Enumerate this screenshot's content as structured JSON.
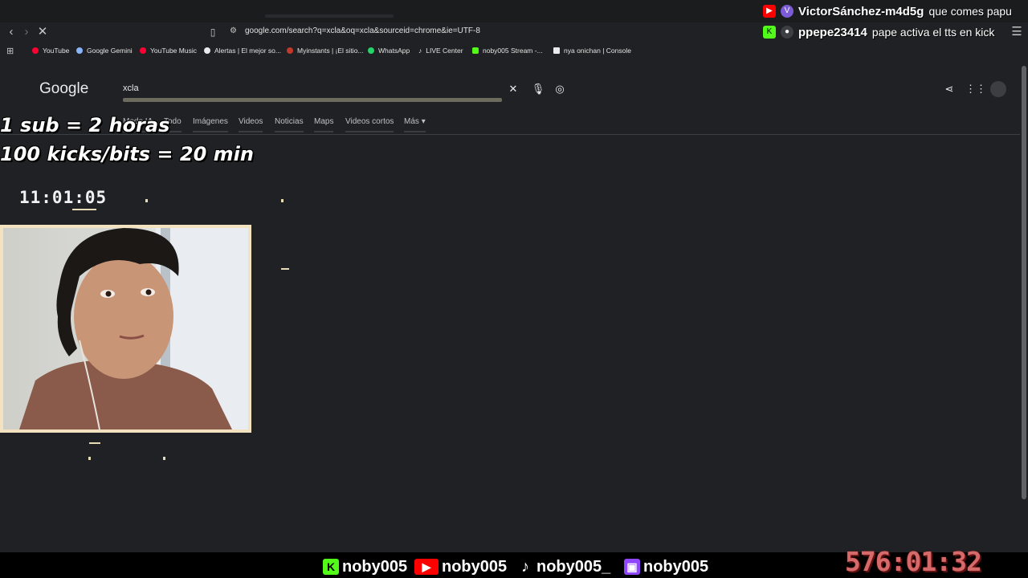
{
  "browser": {
    "url": "google.com/search?q=xcla&oq=xcla&sourceid=chrome&ie=UTF-8",
    "bookmarks": [
      {
        "label": "YouTube",
        "color": "#ff0033"
      },
      {
        "label": "Google Gemini",
        "color": "#8ab4f8"
      },
      {
        "label": "YouTube Music",
        "color": "#ff0033"
      },
      {
        "label": "Alertas | El mejor so...",
        "color": "#e8eaed"
      },
      {
        "label": "Myinstants | ¡El sitio...",
        "color": "#c0392b"
      },
      {
        "label": "WhatsApp",
        "color": "#25d366"
      },
      {
        "label": "LIVE Center",
        "color": "#e8eaed"
      },
      {
        "label": "noby005 Stream -...",
        "color": "#53fc18"
      },
      {
        "label": "nya onichan | Console",
        "color": "#e8eaed"
      }
    ]
  },
  "google": {
    "logo": "Google",
    "query": "xcla",
    "tabs": [
      "Modo IA",
      "Todo",
      "Imágenes",
      "Videos",
      "Noticias",
      "Maps",
      "Videos cortos",
      "Más"
    ]
  },
  "overlay": {
    "sub_rule": "1 sub = 2 horas",
    "kicks_rule": "100 kicks/bits = 20 min",
    "clock": "11:01:05",
    "big_timer": "576:01:32"
  },
  "chat": [
    {
      "platform": "youtube",
      "badge": "V",
      "name": "VictorSánchez-m4d5g",
      "message": "que comes papu"
    },
    {
      "platform": "kick",
      "badge": "",
      "name": "ppepe23414",
      "message": "pape activa el tts en kick"
    }
  ],
  "socials": [
    {
      "platform": "kick",
      "handle": "noby005",
      "color": "#53fc18"
    },
    {
      "platform": "youtube",
      "handle": "noby005",
      "color": "#ff0000"
    },
    {
      "platform": "tiktok",
      "handle": "noby005_",
      "color": "#ffffff"
    },
    {
      "platform": "twitch",
      "handle": "noby005",
      "color": "#9146ff"
    }
  ]
}
